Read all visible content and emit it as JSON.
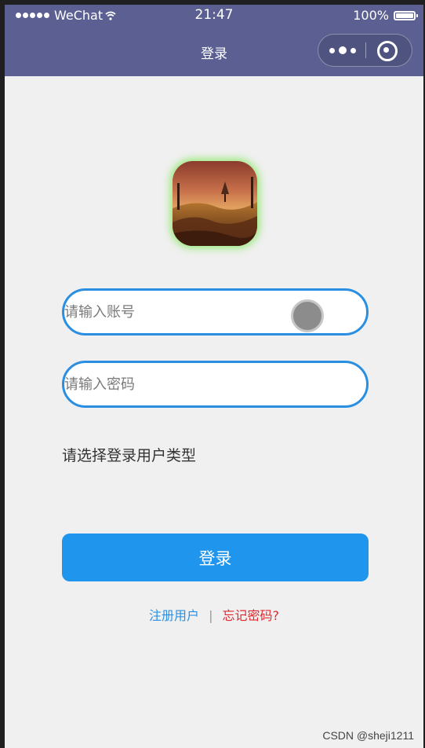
{
  "status_bar": {
    "carrier": "WeChat",
    "time": "21:47",
    "battery": "100%"
  },
  "nav": {
    "title": "登录"
  },
  "form": {
    "account_placeholder": "请输入账号",
    "password_placeholder": "请输入密码",
    "user_type_label": "请选择登录用户类型",
    "login_button": "登录"
  },
  "links": {
    "register": "注册用户",
    "divider": "|",
    "forgot": "忘记密码?"
  },
  "watermark": "CSDN @sheji1211",
  "colors": {
    "nav_bg": "#5b5f92",
    "accent": "#1f95ee",
    "forgot": "#e0282e"
  },
  "icons": [
    "signal-icon",
    "wifi-icon",
    "battery-icon",
    "more-icon",
    "close-icon",
    "app-logo"
  ]
}
